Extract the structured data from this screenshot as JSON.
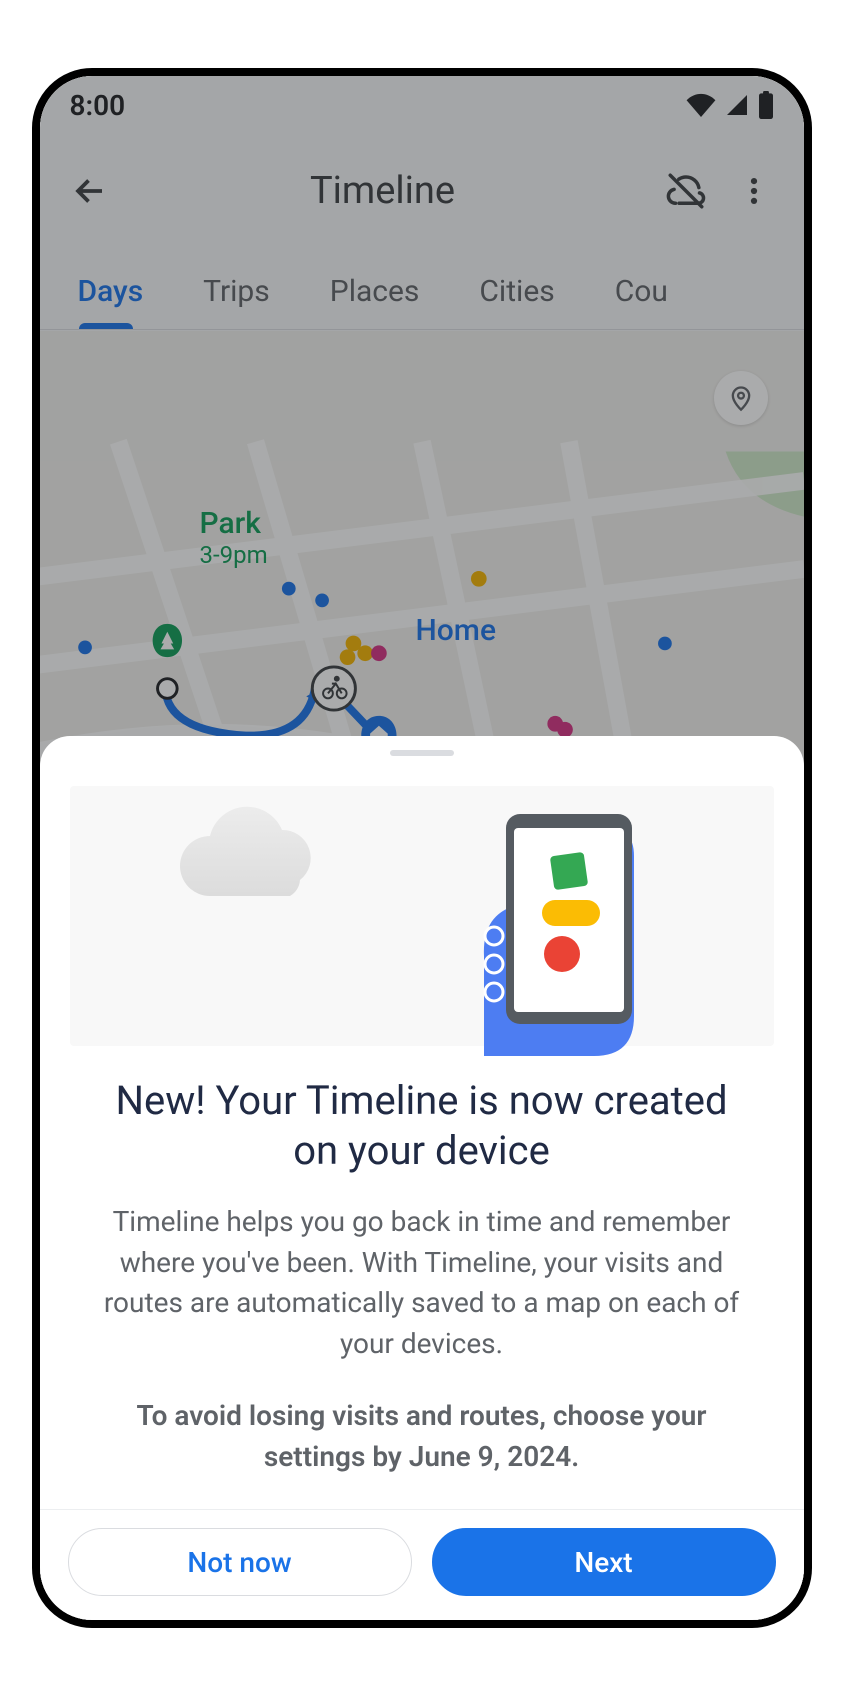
{
  "status": {
    "time": "8:00"
  },
  "header": {
    "title": "Timeline"
  },
  "tabs": [
    "Days",
    "Trips",
    "Places",
    "Cities",
    "Cou"
  ],
  "map": {
    "places": [
      {
        "name": "Park",
        "time": "3-9pm"
      },
      {
        "name": "Home"
      }
    ]
  },
  "sheet": {
    "title": "New! Your Timeline is now created on your device",
    "body": "Timeline helps you go back in time and remember where you've been.  With Timeline, your visits and routes are automatically saved to a map on each of your devices.",
    "deadline": "To avoid losing visits and routes, choose your settings by June 9, 2024.",
    "buttons": {
      "secondary": "Not now",
      "primary": "Next"
    }
  }
}
